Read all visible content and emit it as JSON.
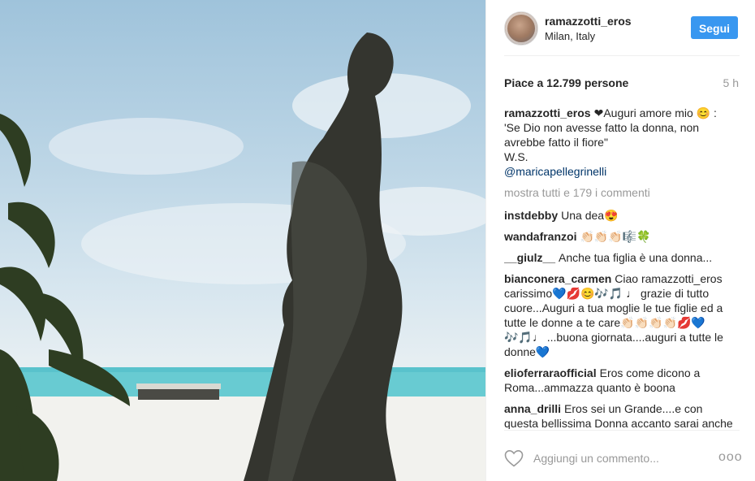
{
  "post": {
    "username": "ramazzotti_eros",
    "location": "Milan, Italy",
    "follow_label": "Segui",
    "likes_text": "Piace a 12.799 persone",
    "time_text": "5 h"
  },
  "caption": {
    "username": "ramazzotti_eros",
    "text": "❤Auguri amore mio 😊 :\n'Se Dio non avesse fatto la donna, non avrebbe fatto il fiore\"\nW.S.",
    "mention": "@maricapellegrinelli"
  },
  "show_more": "mostra tutti e 179 i commenti",
  "comments": [
    {
      "user": "instdebby",
      "text": "Una dea😍"
    },
    {
      "user": "wandafranzoi",
      "text": "👏🏻👏🏻👏🏻🎼🍀"
    },
    {
      "user": "__giulz__",
      "text": "Anche tua figlia è una donna..."
    },
    {
      "user": "bianconera_carmen",
      "text": "Ciao ramazzotti_eros carissimo💙💋😊🎶🎵 ♩ grazie di tutto cuore...Auguri a tua moglie le tue figlie ed a tutte le donne a te care👏🏻👏🏻👏🏻👏🏻💋💙 🎶🎵♩ ...buona giornata....auguri a tutte le donne💙"
    },
    {
      "user": "elioferraraofficial",
      "text": "Eros come dicono a Roma...ammazza quanto è boona"
    },
    {
      "user": "anna_drilli",
      "text": "Eros sei un Grande....e con questa bellissima Donna accanto sarai anche il più felice di tutti"
    }
  ],
  "footer": {
    "add_comment_placeholder": "Aggiungi un commento...",
    "more_label": "ooo"
  },
  "colors": {
    "accent": "#3897f0",
    "mention": "#003569",
    "muted": "#999999"
  },
  "icons": {
    "like": "heart-icon",
    "options": "more-options-icon"
  }
}
